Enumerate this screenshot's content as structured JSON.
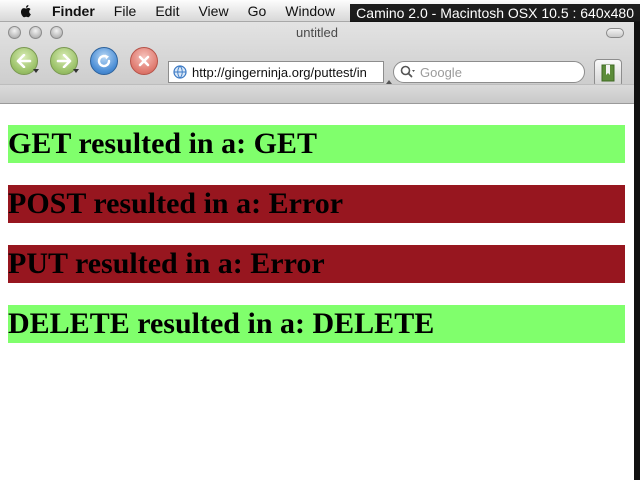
{
  "menubar": {
    "items": [
      "Finder",
      "File",
      "Edit",
      "View",
      "Go",
      "Window"
    ]
  },
  "overlay_caption": "Camino 2.0 - Macintosh OSX 10.5 : 640x480",
  "window": {
    "title": "untitled"
  },
  "toolbar": {
    "url": "http://gingerninja.org/puttest/in",
    "search_placeholder": "Google"
  },
  "colors": {
    "success": "#80ff6c",
    "error": "#97161f"
  },
  "results": [
    {
      "text": "GET resulted in a: GET",
      "status": "success"
    },
    {
      "text": "POST resulted in a: Error",
      "status": "error"
    },
    {
      "text": "PUT resulted in a: Error",
      "status": "error"
    },
    {
      "text": "DELETE resulted in a: DELETE",
      "status": "success"
    }
  ]
}
